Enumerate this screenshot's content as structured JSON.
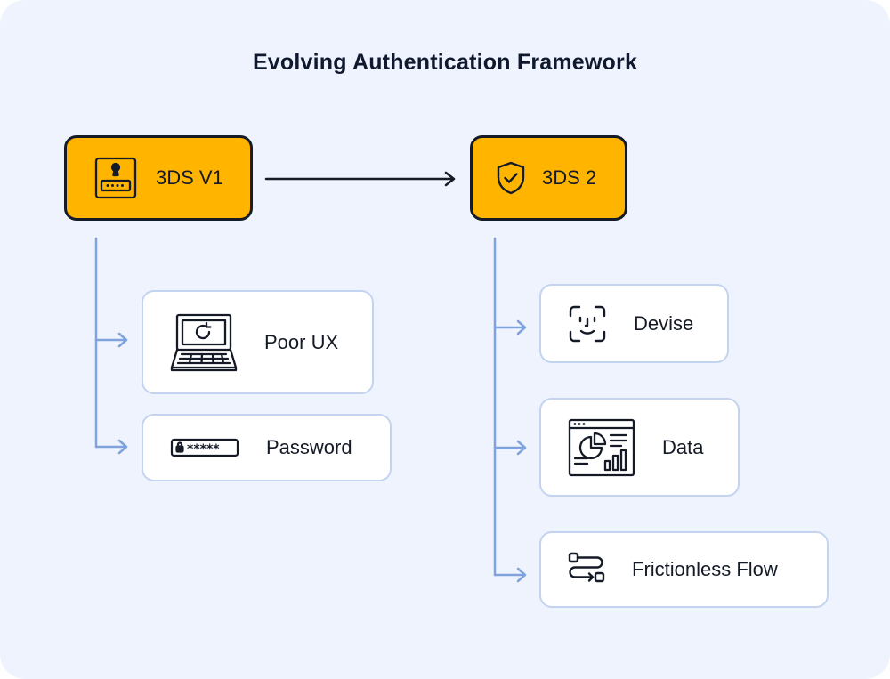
{
  "title": "Evolving Authentication Framework",
  "colors": {
    "background": "#eef3fd",
    "root_fill": "#ffb400",
    "root_border": "#141a26",
    "card_border": "#c3d4f1",
    "connector": "#7fa3dc",
    "arrow": "#141a26"
  },
  "left": {
    "root": {
      "label": "3DS V1",
      "icon": "keyhole-password-card-icon"
    },
    "items": [
      {
        "label": "Poor UX",
        "icon": "laptop-refresh-icon"
      },
      {
        "label": "Password",
        "icon": "masked-password-icon"
      }
    ]
  },
  "right": {
    "root": {
      "label": "3DS 2",
      "icon": "shield-check-icon"
    },
    "items": [
      {
        "label": "Devise",
        "icon": "face-id-icon"
      },
      {
        "label": "Data",
        "icon": "analytics-dashboard-icon"
      },
      {
        "label": "Frictionless Flow",
        "icon": "flow-icon"
      }
    ]
  }
}
